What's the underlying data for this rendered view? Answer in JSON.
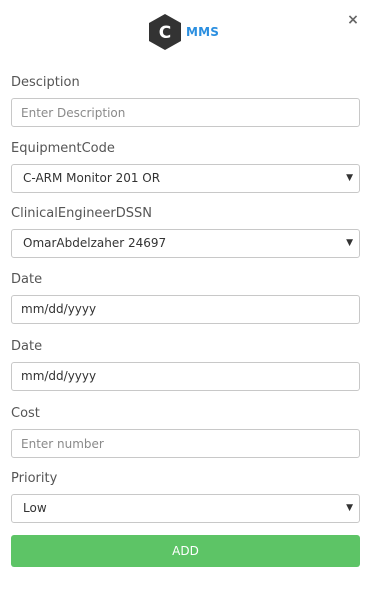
{
  "logo": {
    "letter": "C",
    "text": "MMS"
  },
  "close_label": "×",
  "fields": {
    "description": {
      "label": "Desciption",
      "value": "",
      "placeholder": "Enter Description"
    },
    "equipment_code": {
      "label": "EquipmentCode",
      "selected": "C-ARM Monitor 201 OR"
    },
    "clinical_engineer": {
      "label": "ClinicalEngineerDSSN",
      "selected": "OmarAbdelzaher 24697"
    },
    "date1": {
      "label": "Date",
      "value": "mm/dd/yyyy"
    },
    "date2": {
      "label": "Date",
      "value": "mm/dd/yyyy"
    },
    "cost": {
      "label": "Cost",
      "value": "",
      "placeholder": "Enter number"
    },
    "priority": {
      "label": "Priority",
      "selected": "Low"
    }
  },
  "add_button": {
    "label": "ADD"
  },
  "colors": {
    "accent": "#2b8fe0",
    "button": "#5dc466",
    "logo_hex": "#333333"
  },
  "icons": {
    "close": "close-icon",
    "select_caret": "caret-down-icon"
  }
}
